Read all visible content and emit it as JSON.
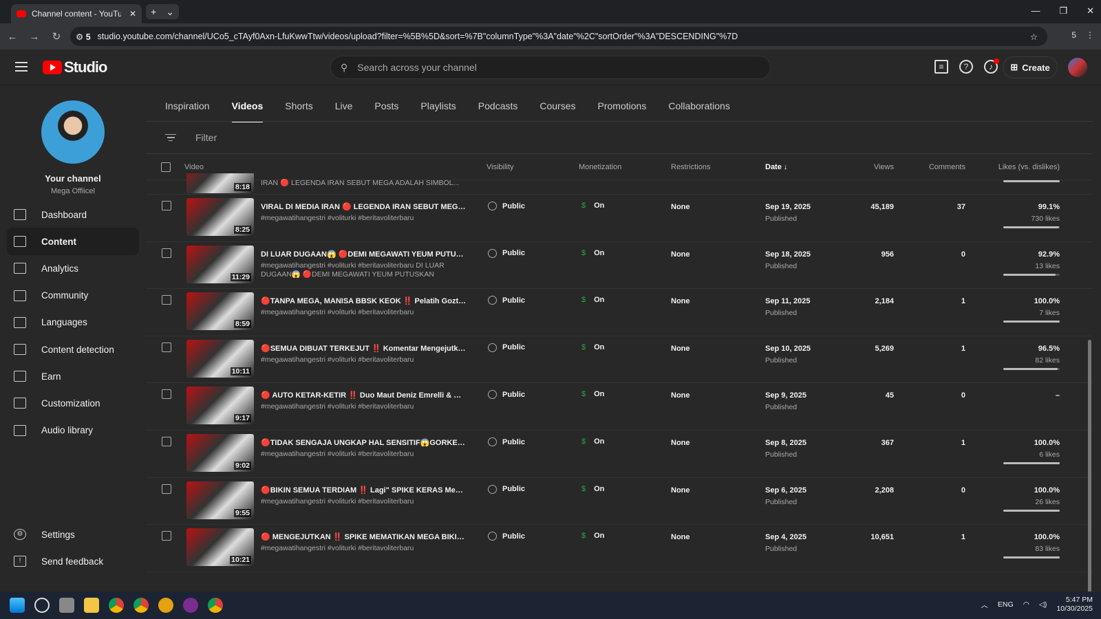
{
  "browser": {
    "tab_title": "Channel content - YouTube Studio",
    "url": "studio.youtube.com/channel/UCo5_cTAyf0Axn-LfuKwwTtw/videos/upload?filter=%5B%5D&sort=%7B\"columnType\"%3A\"date\"%2C\"sortOrder\"%3A\"DESCENDING\"%7D",
    "site_settings_count": "5",
    "ext_count": "5"
  },
  "header": {
    "logo": "Studio",
    "search_placeholder": "Search across your channel",
    "create_label": "Create"
  },
  "channel": {
    "name": "Your channel",
    "handle": "Mega Offiicel"
  },
  "sidebar": {
    "items": [
      {
        "label": "Dashboard",
        "icon": "dashboard-icon"
      },
      {
        "label": "Content",
        "icon": "content-icon",
        "active": true
      },
      {
        "label": "Analytics",
        "icon": "analytics-icon"
      },
      {
        "label": "Community",
        "icon": "community-icon"
      },
      {
        "label": "Languages",
        "icon": "languages-icon"
      },
      {
        "label": "Content detection",
        "icon": "copyright-icon"
      },
      {
        "label": "Earn",
        "icon": "dollar-icon"
      },
      {
        "label": "Customization",
        "icon": "wand-icon"
      },
      {
        "label": "Audio library",
        "icon": "audio-library-icon"
      }
    ],
    "settings": "Settings",
    "feedback": "Send feedback"
  },
  "tabs": [
    "Inspiration",
    "Videos",
    "Shorts",
    "Live",
    "Posts",
    "Playlists",
    "Podcasts",
    "Courses",
    "Promotions",
    "Collaborations"
  ],
  "active_tab": "Videos",
  "filter_placeholder": "Filter",
  "columns": {
    "video": "Video",
    "visibility": "Visibility",
    "monetization": "Monetization",
    "restrictions": "Restrictions",
    "date": "Date",
    "views": "Views",
    "comments": "Comments",
    "likes": "Likes (vs. dislikes)"
  },
  "partial_row": {
    "duration": "8:18",
    "desc": "IRAN 🔴 LEGENDA IRAN SEBUT MEGA ADALAH SIMBOL..."
  },
  "videos": [
    {
      "duration": "8:25",
      "title": "VIRAL DI MEDIA IRAN 🔴 LEGENDA IRAN SEBUT MEGA ADA...",
      "desc": "#megawatihangestri #voliturki #beritavoliterbaru",
      "visibility": "Public",
      "monetization": "On",
      "restrictions": "None",
      "date": "Sep 19, 2025",
      "status": "Published",
      "views": "45,189",
      "comments": "37",
      "likes_pct": "99.1%",
      "likes": "730 likes",
      "like_ratio": 0.991
    },
    {
      "duration": "11:29",
      "title": "DI LUAR DUGAAN😱 🔴DEMI MEGAWATI YEUM PUTUSKAN ...",
      "desc": "#megawatihangestri #voliturki #beritavoliterbaru DI LUAR DUGAAN😱 🔴DEMI MEGAWATI YEUM PUTUSKAN KONTRAKNY...",
      "visibility": "Public",
      "monetization": "On",
      "restrictions": "None",
      "date": "Sep 18, 2025",
      "status": "Published",
      "views": "956",
      "comments": "0",
      "likes_pct": "92.9%",
      "likes": "13 likes",
      "like_ratio": 0.929
    },
    {
      "duration": "8:59",
      "title": "🔴TANPA MEGA, MANISA BBSK KEOK ‼️ Pelatih Goztepe A...",
      "desc": "#megawatihangestri #voliturki #beritavoliterbaru",
      "visibility": "Public",
      "monetization": "On",
      "restrictions": "None",
      "date": "Sep 11, 2025",
      "status": "Published",
      "views": "2,184",
      "comments": "1",
      "likes_pct": "100.0%",
      "likes": "7 likes",
      "like_ratio": 1
    },
    {
      "duration": "10:11",
      "title": "🔴SEMUA DIBUAT TERKEJUT ‼️ Komentar Mengejutkan Zeh...",
      "desc": "#megawatihangestri #voliturki #beritavoliterbaru",
      "visibility": "Public",
      "monetization": "On",
      "restrictions": "None",
      "date": "Sep 10, 2025",
      "status": "Published",
      "views": "5,269",
      "comments": "1",
      "likes_pct": "96.5%",
      "likes": "82 likes",
      "like_ratio": 0.965
    },
    {
      "duration": "9:17",
      "title": "🔴 AUTO KETAR-KETIR ‼️ Duo Maut Deniz Emrelli & Megawa...",
      "desc": "#megawatihangestri #voliturki #beritavoliterbaru",
      "visibility": "Public",
      "monetization": "On",
      "restrictions": "None",
      "date": "Sep 9, 2025",
      "status": "Published",
      "views": "45",
      "comments": "0",
      "likes_pct": "–",
      "likes": "",
      "like_ratio": null
    },
    {
      "duration": "9:02",
      "title": "🔴TIDAK SENGAJA UNGKAP HAL SENSITIF😱GORKEM KAZ...",
      "desc": "#megawatihangestri #voliturki #beritavoliterbaru",
      "visibility": "Public",
      "monetization": "On",
      "restrictions": "None",
      "date": "Sep 8, 2025",
      "status": "Published",
      "views": "367",
      "comments": "1",
      "likes_pct": "100.0%",
      "likes": "6 likes",
      "like_ratio": 1
    },
    {
      "duration": "9:55",
      "title": "🔴BIKIN SEMUA TERDIAM ‼️ Lagi\" SPIKE KERAS Mega Buat ...",
      "desc": "#megawatihangestri #voliturki #beritavoliterbaru",
      "visibility": "Public",
      "monetization": "On",
      "restrictions": "None",
      "date": "Sep 6, 2025",
      "status": "Published",
      "views": "2,208",
      "comments": "0",
      "likes_pct": "100.0%",
      "likes": "26 likes",
      "like_ratio": 1
    },
    {
      "duration": "10:21",
      "title": "🔴 MENGEJUTKAN ‼️ SPIKE MEMATIKAN MEGA BIKIN PEL...",
      "desc": "#megawatihangestri #voliturki #beritavoliterbaru",
      "visibility": "Public",
      "monetization": "On",
      "restrictions": "None",
      "date": "Sep 4, 2025",
      "status": "Published",
      "views": "10,651",
      "comments": "1",
      "likes_pct": "100.0%",
      "likes": "83 likes",
      "like_ratio": 1
    }
  ],
  "taskbar": {
    "lang": "ENG",
    "time": "5:47 PM",
    "date": "10/30/2025"
  }
}
